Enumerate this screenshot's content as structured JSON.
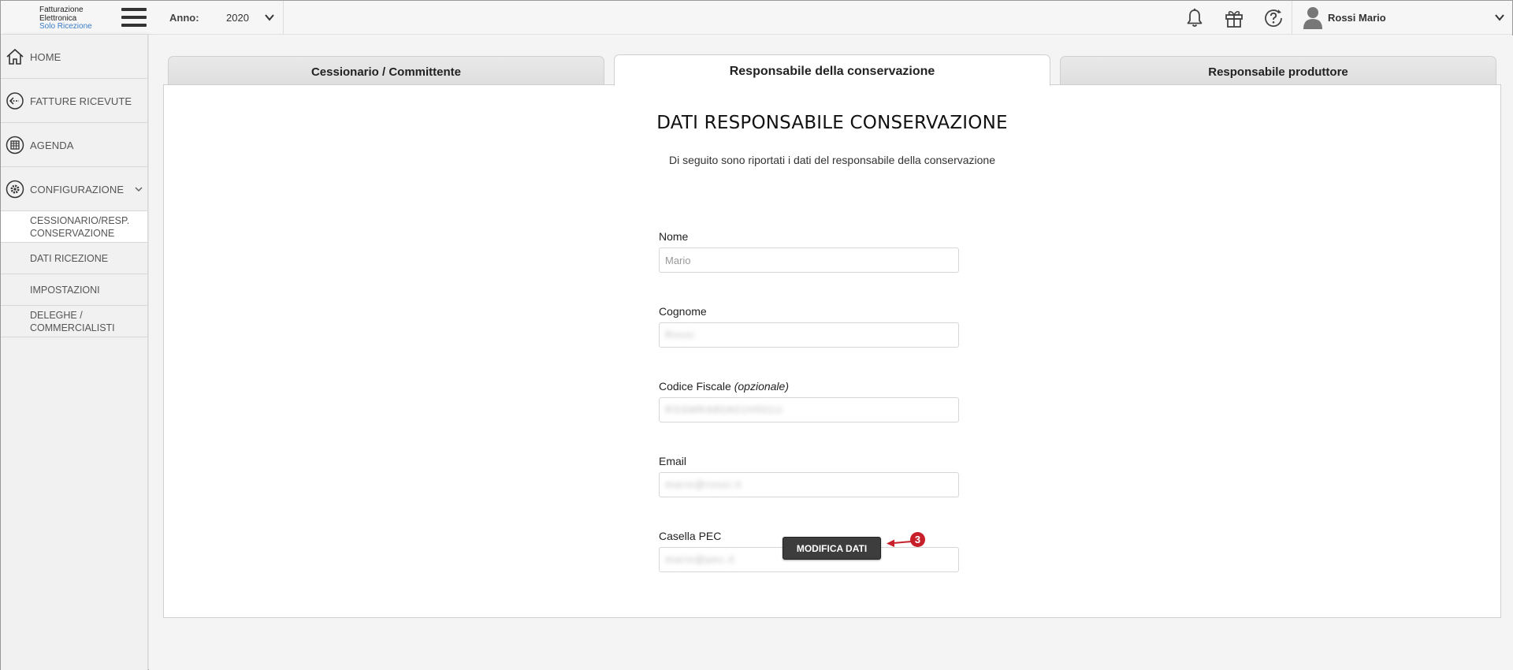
{
  "app": {
    "logo_line1": "Fatturazione",
    "logo_line2": "Elettronica",
    "logo_line3": "Solo Ricezione",
    "menu_icon": "hamburger-menu-icon"
  },
  "header": {
    "year_label": "Anno:",
    "year_value": "2020",
    "icons": [
      "bell-icon",
      "gift-icon",
      "help-icon"
    ],
    "user_name": "Rossi Mario"
  },
  "sidebar": {
    "items": [
      {
        "label": "HOME",
        "icon": "home-icon"
      },
      {
        "label": "FATTURE RICEVUTE",
        "icon": "arrow-left-circle-icon"
      },
      {
        "label": "AGENDA",
        "icon": "calendar-icon"
      },
      {
        "label": "CONFIGURAZIONE",
        "icon": "gear-icon"
      }
    ],
    "subitems": [
      {
        "label_line1": "CESSIONARIO/RESP.",
        "label_line2": "CONSERVAZIONE",
        "active": true
      },
      {
        "label": "DATI RICEZIONE"
      },
      {
        "label": "IMPOSTAZIONI"
      },
      {
        "label_line1": "DELEGHE /",
        "label_line2": "COMMERCIALISTI"
      }
    ]
  },
  "tabs": [
    {
      "label": "Cessionario / Committente",
      "active": false
    },
    {
      "label": "Responsabile della conservazione",
      "active": true
    },
    {
      "label": "Responsabile produttore",
      "active": false
    }
  ],
  "panel": {
    "title": "DATI RESPONSABILE CONSERVAZIONE",
    "subtitle": "Di seguito sono riportati i dati del responsabile della conservazione",
    "fields": {
      "nome": {
        "label": "Nome",
        "value": "Mario"
      },
      "cognome": {
        "label": "Cognome",
        "value": "Rossi"
      },
      "codice_fiscale": {
        "label": "Codice Fiscale",
        "label_note": "(opzionale)",
        "value": "RSSMRA80A01H501U"
      },
      "email": {
        "label": "Email",
        "value": "mario@rossi.it"
      },
      "pec": {
        "label": "Casella PEC",
        "value": "mario@pec.it"
      }
    },
    "button_label": "MODIFICA DATI",
    "annotation_number": "3"
  },
  "colors": {
    "accent_logo": "#3a7bc8",
    "button_bg": "#3d3d3d",
    "annotation_red": "#c8202a"
  }
}
